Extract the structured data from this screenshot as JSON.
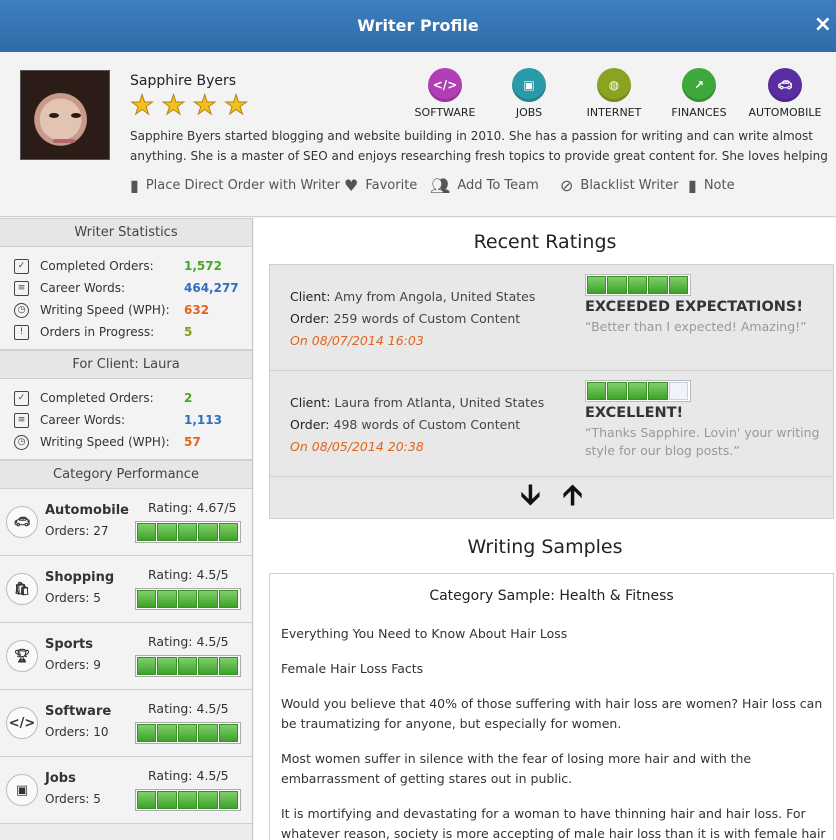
{
  "window": {
    "title": "Writer Profile",
    "close_label": "×"
  },
  "writer": {
    "name": "Sapphire Byers",
    "stars": [
      "★",
      "★",
      "★",
      "★"
    ],
    "bio": "Sapphire Byers started blogging and website building in 2010. She has a passion for writing and can write almost anything. She is a master of SEO and enjoys researching fresh topics to provide great content for. She loves helping others bring their visions to life"
  },
  "categories": [
    {
      "label": "SOFTWARE",
      "glyph": "</>",
      "color": "#b03fb5",
      "icon": "code-icon"
    },
    {
      "label": "JOBS",
      "glyph": "▣",
      "color": "#2a9aa8",
      "icon": "id-card-icon"
    },
    {
      "label": "INTERNET",
      "glyph": "◍",
      "color": "#8aa320",
      "icon": "globe-icon"
    },
    {
      "label": "FINANCES",
      "glyph": "↗",
      "color": "#3fa83a",
      "icon": "chart-icon"
    },
    {
      "label": "AUTOMOBILE",
      "glyph": "🚗︎",
      "color": "#5a2ea3",
      "icon": "car-icon"
    }
  ],
  "actions": {
    "place_order": "Place Direct Order with Writer",
    "favorite": "Favorite",
    "add_team": "Add To Team",
    "blacklist": "Blacklist Writer",
    "note": "Note"
  },
  "writer_statistics": {
    "heading": "Writer Statistics",
    "items": [
      {
        "label": "Completed Orders:",
        "value": "1,572"
      },
      {
        "label": "Career Words:",
        "value": "464,277"
      },
      {
        "label": "Writing Speed (WPH):",
        "value": "632"
      },
      {
        "label": "Orders in Progress:",
        "value": "5"
      }
    ]
  },
  "client_statistics": {
    "heading": "For Client: Laura",
    "items": [
      {
        "label": "Completed Orders:",
        "value": "2"
      },
      {
        "label": "Career Words:",
        "value": "1,113"
      },
      {
        "label": "Writing Speed (WPH):",
        "value": "57"
      }
    ]
  },
  "category_performance": {
    "heading": "Category Performance",
    "items": [
      {
        "name": "Automobile",
        "orders": "Orders: 27",
        "rating": "Rating: 4.67/5",
        "score": 4.67,
        "icon": "car-icon",
        "glyph": "🚗︎"
      },
      {
        "name": "Shopping",
        "orders": "Orders: 5",
        "rating": "Rating: 4.5/5",
        "score": 4.5,
        "icon": "shopping-bag-icon",
        "glyph": "🛍︎"
      },
      {
        "name": "Sports",
        "orders": "Orders: 9",
        "rating": "Rating: 4.5/5",
        "score": 4.5,
        "icon": "trophy-icon",
        "glyph": "🏆︎"
      },
      {
        "name": "Software",
        "orders": "Orders: 10",
        "rating": "Rating: 4.5/5",
        "score": 4.5,
        "icon": "code-icon",
        "glyph": "</>"
      },
      {
        "name": "Jobs",
        "orders": "Orders: 5",
        "rating": "Rating: 4.5/5",
        "score": 4.5,
        "icon": "id-card-icon",
        "glyph": "▣"
      }
    ]
  },
  "recent_ratings": {
    "heading": "Recent Ratings",
    "items": [
      {
        "client_label": "Client:",
        "client": "Amy from Angola, United States",
        "order_label": "Order:",
        "order": "259 words of Custom Content",
        "date": "On 08/07/2014 16:03",
        "verdict": "EXCEEDED EXPECTATIONS!",
        "quote": "“Better than I expected! Amazing!”",
        "score": 5
      },
      {
        "client_label": "Client:",
        "client": "Laura from Atlanta, United States",
        "order_label": "Order:",
        "order": "498 words of Custom Content",
        "date": "On 08/05/2014 20:38",
        "verdict": "EXCELLENT!",
        "quote": "“Thanks Sapphire. Lovin' your writing style for our blog posts.”",
        "score": 4
      }
    ],
    "down_arrow": "🡫",
    "up_arrow": "🡩"
  },
  "writing_samples": {
    "heading": "Writing Samples",
    "sample_heading": "Category Sample: Health & Fitness",
    "paragraphs": [
      "Everything You Need to Know About Hair Loss",
      "Female Hair Loss Facts",
      "Would you believe that 40% of those suffering with hair loss are women? Hair loss can be traumatizing for anyone, but especially for women.",
      "Most women suffer in silence with the fear of losing more hair and with the embarrassment of getting stares out in public.",
      "It is mortifying and devastating for a woman to have thinning hair and hair loss. For whatever reason, society is more accepting of male hair loss than it is with female hair loss."
    ]
  }
}
